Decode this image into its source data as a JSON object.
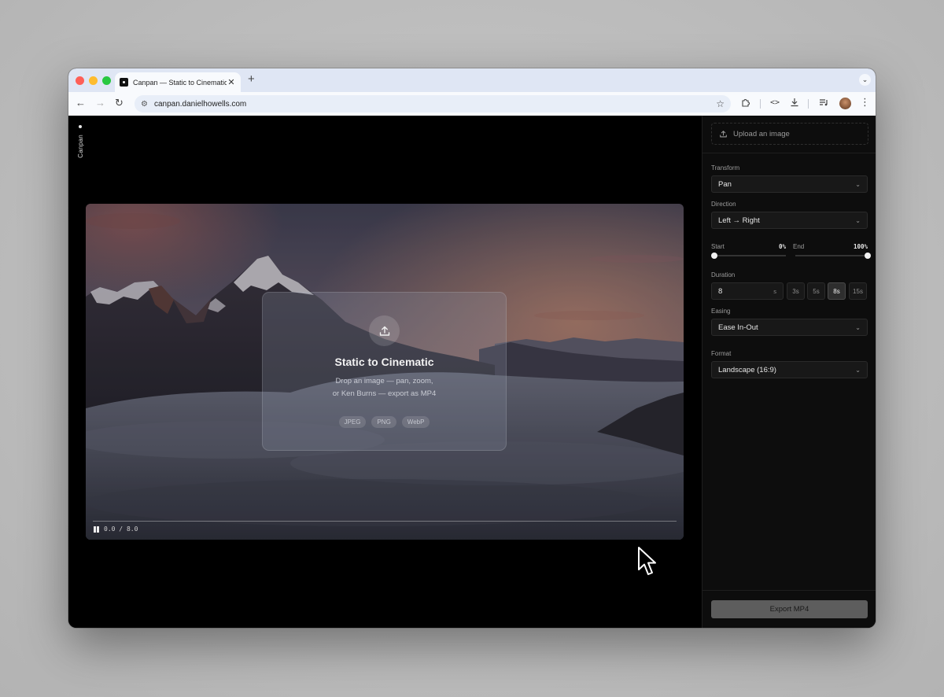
{
  "browser": {
    "tab_title": "Canpan — Static to Cinematic",
    "url": "canpan.danielhowells.com",
    "new_tab_glyph": "+",
    "tab_close_glyph": "✕"
  },
  "app": {
    "brand": "Canpan",
    "hero": {
      "title": "Static to Cinematic",
      "line1": "Drop an image — pan, zoom,",
      "line2": "or Ken Burns — export as MP4",
      "formats": [
        "JPEG",
        "PNG",
        "WebP"
      ]
    },
    "player": {
      "current": "0.0",
      "separator": "/",
      "total": "8.0",
      "progress": 0
    }
  },
  "sidebar": {
    "upload_label": "Upload an image",
    "transform": {
      "label": "Transform",
      "value": "Pan"
    },
    "direction": {
      "label": "Direction",
      "value": "Left → Right"
    },
    "start": {
      "label": "Start",
      "value": "0%",
      "fraction": 0.0
    },
    "end": {
      "label": "End",
      "value": "100%",
      "fraction": 1.0
    },
    "duration": {
      "label": "Duration",
      "value": "8",
      "unit": "s",
      "presets": [
        "3s",
        "5s",
        "8s",
        "15s"
      ],
      "active_preset": "8s"
    },
    "easing": {
      "label": "Easing",
      "value": "Ease In-Out"
    },
    "format": {
      "label": "Format",
      "value": "Landscape (16:9)"
    },
    "export_label": "Export MP4"
  },
  "colors": {
    "accent_text": "#e6e6e6",
    "sidebar_bg": "#0d0d0d",
    "export_button": "#5d5d5d",
    "traffic_red": "#fe5f57",
    "traffic_yellow": "#febc2e",
    "traffic_green": "#28c840"
  }
}
